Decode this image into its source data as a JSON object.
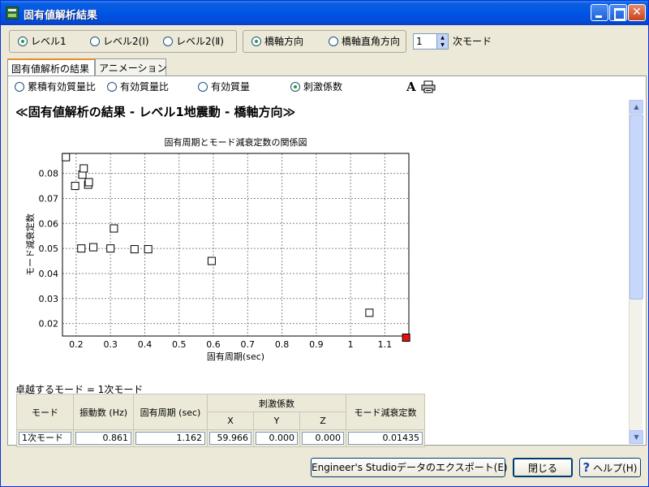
{
  "window": {
    "title": "固有値解析結果"
  },
  "level_options": [
    {
      "label": "レベル1",
      "selected": true
    },
    {
      "label": "レベル2(Ⅰ)",
      "selected": false
    },
    {
      "label": "レベル2(Ⅱ)",
      "selected": false
    }
  ],
  "direction_options": [
    {
      "label": "橋軸方向",
      "selected": true
    },
    {
      "label": "橋軸直角方向",
      "selected": false
    }
  ],
  "mode_spinner": {
    "value": "1",
    "suffix": "次モード"
  },
  "tabs": [
    {
      "label": "固有値解析の結果",
      "active": true
    },
    {
      "label": "アニメーション",
      "active": false
    }
  ],
  "display_options": [
    {
      "label": "累積有効質量比",
      "selected": false
    },
    {
      "label": "有効質量比",
      "selected": false
    },
    {
      "label": "有効質量",
      "selected": false
    },
    {
      "label": "刺激係数",
      "selected": true
    }
  ],
  "toolbar_icons": [
    "font-icon",
    "printer-icon"
  ],
  "main": {
    "heading": "≪固有値解析の結果 - レベル1地震動 - 橋軸方向≫"
  },
  "chart_data": {
    "type": "scatter",
    "title": "固有周期とモード減衰定数の関係図",
    "xlabel": "固有周期(sec)",
    "ylabel": "モード減衰定数",
    "xlim": [
      0.16,
      1.17
    ],
    "ylim": [
      0.015,
      0.088
    ],
    "xticks": [
      0.2,
      0.3,
      0.4,
      0.5,
      0.6,
      0.7,
      0.8,
      0.9,
      1.0,
      1.1
    ],
    "xtick_labels": [
      "0.2",
      "0.3",
      "0.4",
      "0.5",
      "0.6",
      "0.7",
      "0.8",
      "0.9",
      "1",
      "1.1"
    ],
    "yticks": [
      0.02,
      0.03,
      0.04,
      0.05,
      0.06,
      0.07,
      0.08
    ],
    "ytick_labels": [
      "0.02",
      "0.03",
      "0.04",
      "0.05",
      "0.06",
      "0.07",
      "0.08"
    ],
    "grid": true,
    "points": [
      {
        "x": 0.17,
        "y": 0.0865
      },
      {
        "x": 0.197,
        "y": 0.075
      },
      {
        "x": 0.215,
        "y": 0.05
      },
      {
        "x": 0.218,
        "y": 0.0795
      },
      {
        "x": 0.222,
        "y": 0.082
      },
      {
        "x": 0.235,
        "y": 0.0755
      },
      {
        "x": 0.237,
        "y": 0.0765
      },
      {
        "x": 0.25,
        "y": 0.0505
      },
      {
        "x": 0.3,
        "y": 0.05
      },
      {
        "x": 0.31,
        "y": 0.058
      },
      {
        "x": 0.37,
        "y": 0.0497
      },
      {
        "x": 0.41,
        "y": 0.0497
      },
      {
        "x": 0.595,
        "y": 0.045
      },
      {
        "x": 1.055,
        "y": 0.0243
      }
    ],
    "highlight": {
      "x": 1.162,
      "y": 0.01435,
      "color": "#e81010"
    },
    "marker_color": "#000000"
  },
  "dominant_mode": {
    "text": "卓越するモード = 1次モード"
  },
  "table": {
    "headers": {
      "mode": "モード",
      "frequency": "振動数 (Hz)",
      "period": "固有周期 (sec)",
      "participation": "刺激係数",
      "x": "X",
      "y": "Y",
      "z": "Z",
      "damping": "モード減衰定数"
    },
    "row": {
      "mode": "1次モード",
      "frequency": "0.861",
      "period": "1.162",
      "x": "59.966",
      "y": "0.000",
      "z": "0.000",
      "damping": "0.01435"
    }
  },
  "buttons": {
    "export": "Engineer's Studioデータのエクスポート(E)",
    "close": "閉じる",
    "help": "ヘルプ(H)"
  }
}
